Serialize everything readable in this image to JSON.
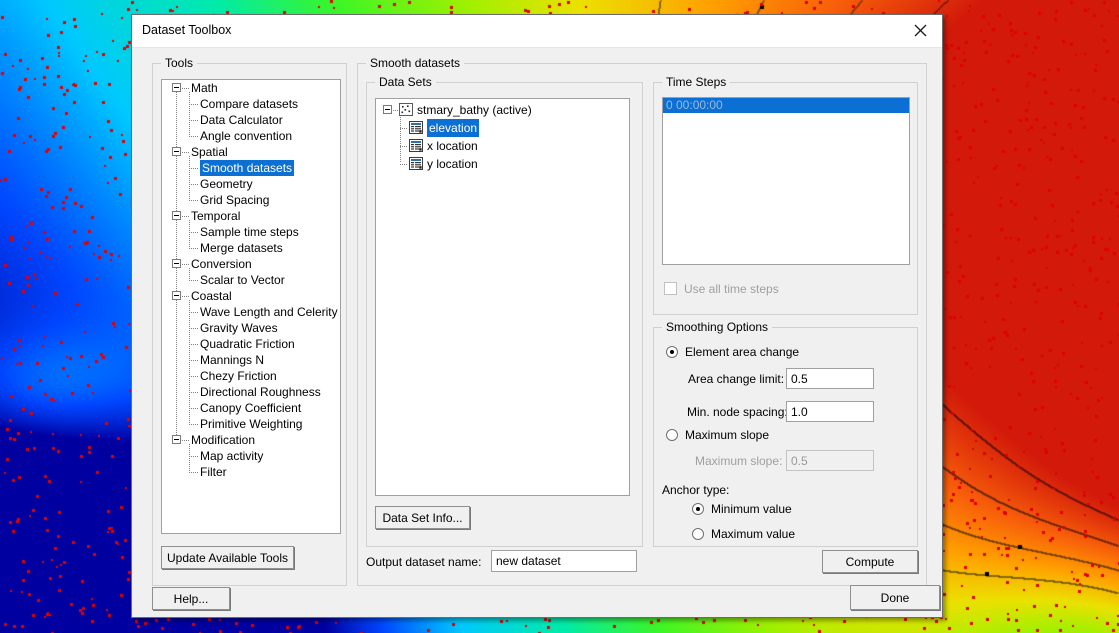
{
  "window": {
    "title": "Dataset Toolbox",
    "close_icon": "close-icon"
  },
  "tools_group": {
    "label": "Tools",
    "tree": [
      {
        "label": "Math",
        "level": 0,
        "expanded": true,
        "selected": false
      },
      {
        "label": "Compare datasets",
        "level": 1,
        "expanded": false,
        "selected": false
      },
      {
        "label": "Data Calculator",
        "level": 1,
        "expanded": false,
        "selected": false
      },
      {
        "label": "Angle convention",
        "level": 1,
        "expanded": false,
        "selected": false
      },
      {
        "label": "Spatial",
        "level": 0,
        "expanded": true,
        "selected": false
      },
      {
        "label": "Smooth datasets",
        "level": 1,
        "expanded": false,
        "selected": true
      },
      {
        "label": "Geometry",
        "level": 1,
        "expanded": false,
        "selected": false
      },
      {
        "label": "Grid Spacing",
        "level": 1,
        "expanded": false,
        "selected": false
      },
      {
        "label": "Temporal",
        "level": 0,
        "expanded": true,
        "selected": false
      },
      {
        "label": "Sample time steps",
        "level": 1,
        "expanded": false,
        "selected": false
      },
      {
        "label": "Merge datasets",
        "level": 1,
        "expanded": false,
        "selected": false
      },
      {
        "label": "Conversion",
        "level": 0,
        "expanded": true,
        "selected": false
      },
      {
        "label": "Scalar to Vector",
        "level": 1,
        "expanded": false,
        "selected": false
      },
      {
        "label": "Coastal",
        "level": 0,
        "expanded": true,
        "selected": false
      },
      {
        "label": "Wave Length and Celerity",
        "level": 1,
        "expanded": false,
        "selected": false
      },
      {
        "label": "Gravity Waves",
        "level": 1,
        "expanded": false,
        "selected": false
      },
      {
        "label": "Quadratic Friction",
        "level": 1,
        "expanded": false,
        "selected": false
      },
      {
        "label": "Mannings N",
        "level": 1,
        "expanded": false,
        "selected": false
      },
      {
        "label": "Chezy Friction",
        "level": 1,
        "expanded": false,
        "selected": false
      },
      {
        "label": "Directional Roughness",
        "level": 1,
        "expanded": false,
        "selected": false
      },
      {
        "label": "Canopy Coefficient",
        "level": 1,
        "expanded": false,
        "selected": false
      },
      {
        "label": "Primitive Weighting",
        "level": 1,
        "expanded": false,
        "selected": false
      },
      {
        "label": "Modification",
        "level": 0,
        "expanded": true,
        "selected": false
      },
      {
        "label": "Map activity",
        "level": 1,
        "expanded": false,
        "selected": false
      },
      {
        "label": "Filter",
        "level": 1,
        "expanded": false,
        "selected": false
      }
    ],
    "update_button": "Update Available Tools"
  },
  "smooth_group": {
    "label": "Smooth datasets",
    "data_sets": {
      "label": "Data Sets",
      "tree": [
        {
          "label": "stmary_bathy (active)",
          "level": 0,
          "icon": "scatter-points-icon",
          "selected": false
        },
        {
          "label": "elevation",
          "level": 1,
          "icon": "dataset-grid-icon",
          "selected": true
        },
        {
          "label": "x location",
          "level": 1,
          "icon": "dataset-grid-icon",
          "selected": false
        },
        {
          "label": "y location",
          "level": 1,
          "icon": "dataset-grid-icon",
          "selected": false
        }
      ],
      "info_button": "Data Set Info..."
    },
    "output_name_label": "Output dataset name:",
    "output_name_value": "new dataset"
  },
  "time_steps": {
    "label": "Time Steps",
    "items": [
      "0 00:00:00"
    ],
    "selected_index": 0,
    "use_all_label": "Use all time steps",
    "use_all_checked": false,
    "use_all_enabled": false
  },
  "smoothing_options": {
    "label": "Smoothing Options",
    "element_area_change": {
      "label": "Element area change",
      "selected": true,
      "area_change_limit_label": "Area change limit:",
      "area_change_limit_value": "0.5",
      "min_node_spacing_label": "Min. node spacing:",
      "min_node_spacing_value": "1.0"
    },
    "maximum_slope": {
      "label": "Maximum slope",
      "selected": false,
      "max_slope_label": "Maximum slope:",
      "max_slope_value": "0.5",
      "enabled": false
    },
    "anchor_type": {
      "label": "Anchor type:",
      "options": [
        {
          "label": "Minimum value",
          "selected": true
        },
        {
          "label": "Maximum value",
          "selected": false
        }
      ]
    }
  },
  "footer": {
    "compute_button": "Compute",
    "help_button": "Help...",
    "done_button": "Done"
  },
  "colors": {
    "selection_blue": "#0b6fd4",
    "dialog_face": "#f0f0f0",
    "field_white": "#ffffff",
    "disabled_gray": "#a0a0a0",
    "scatter_point_red": "#e00000",
    "contour_line_black": "#000000"
  }
}
